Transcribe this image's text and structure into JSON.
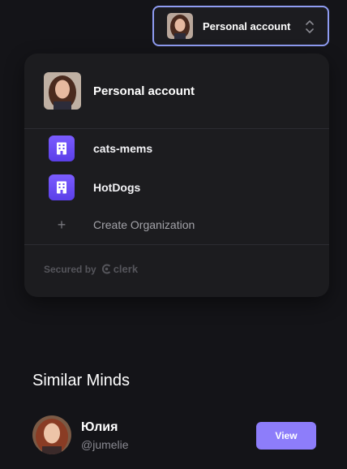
{
  "account_switcher": {
    "label": "Personal account",
    "avatar_icon": "user-avatar-photo",
    "chevron_icon": "chevron-up-down-icon"
  },
  "dropdown": {
    "personal": {
      "label": "Personal account"
    },
    "organizations": [
      {
        "label": "cats-mems",
        "icon": "building-icon"
      },
      {
        "label": "HotDogs",
        "icon": "building-icon"
      }
    ],
    "create": {
      "label": "Create Organization",
      "icon": "plus-icon"
    },
    "footer": {
      "secured_by": "Secured by",
      "brand": "clerk"
    }
  },
  "similar_minds": {
    "title": "Similar Minds",
    "people": [
      {
        "name": "Юлия",
        "handle": "@jumelie",
        "action": "View"
      }
    ]
  },
  "colors": {
    "background": "#141418",
    "panel": "#1c1c1f",
    "accent_border": "#8f9cf2",
    "org_icon": "#6a4cf5",
    "view_button": "#8d7dfa"
  }
}
